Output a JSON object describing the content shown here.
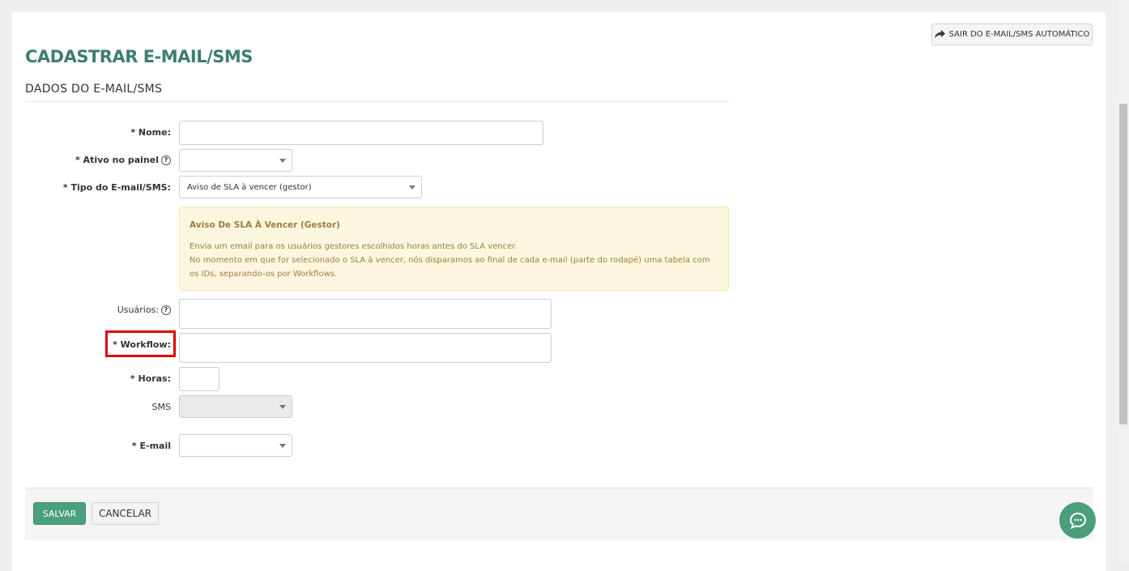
{
  "header": {
    "exit_button_label": "SAIR DO E-MAIL/SMS AUTOMÁTICO",
    "page_title": "CADASTRAR E-MAIL/SMS",
    "section_title": "DADOS DO E-MAIL/SMS"
  },
  "form": {
    "nome_label": "* Nome:",
    "nome_value": "",
    "ativo_label": "* Ativo no painel",
    "ativo_value": "",
    "tipo_label": "* Tipo do E-mail/SMS:",
    "tipo_value": "Aviso de SLA à vencer (gestor)",
    "alert": {
      "title": "Aviso De SLA À Vencer (Gestor)",
      "line1": "Envia um email para os usuários gestores escolhidos horas antes do SLA vencer.",
      "line2": "No momento em que for selecionado o SLA à vencer, nós disparamos ao final de cada e-mail (parte do rodapé) uma tabela com os IDs, separando-os por Workflows."
    },
    "usuarios_label": "Usuários:",
    "workflow_label": "* Workflow:",
    "horas_label": "* Horas:",
    "sms_label": "SMS",
    "email_label": "* E-mail",
    "help_glyph": "?"
  },
  "footer": {
    "save_label": "SALVAR",
    "cancel_label": "CANCELAR"
  },
  "colors": {
    "title": "#3e7d72",
    "save_button": "#4aa07f",
    "chat_button": "#4a9e7a",
    "highlight": "#e00000",
    "alert_bg": "#fcf6df"
  },
  "icons": {
    "exit": "share-arrow-icon",
    "help": "question-circle-icon",
    "chat": "chat-bubble-icon"
  }
}
